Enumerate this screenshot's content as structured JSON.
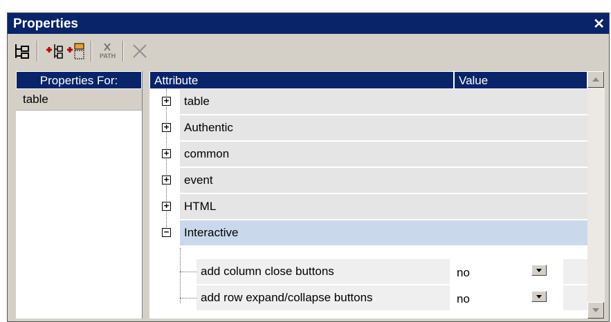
{
  "window": {
    "title": "Properties",
    "close_glyph": "✕"
  },
  "toolbar": {
    "buttons": [
      {
        "icon": "tree-view-icon"
      },
      {
        "icon": "add-property-icon"
      },
      {
        "icon": "add-child-property-icon"
      },
      {
        "icon": "xpath-icon",
        "label": "PATH"
      },
      {
        "icon": "delete-icon"
      }
    ]
  },
  "left": {
    "header": "Properties For:",
    "items": [
      "table"
    ]
  },
  "grid": {
    "attribute_header": "Attribute",
    "value_header": "Value",
    "groups": [
      {
        "label": "table",
        "expanded": false
      },
      {
        "label": "Authentic",
        "expanded": false
      },
      {
        "label": "common",
        "expanded": false
      },
      {
        "label": "event",
        "expanded": false
      },
      {
        "label": "HTML",
        "expanded": false
      },
      {
        "label": "Interactive",
        "expanded": true
      }
    ],
    "children": [
      {
        "attribute": "add column close buttons",
        "value": "no"
      },
      {
        "attribute": "add row expand/collapse buttons",
        "value": "no"
      }
    ]
  },
  "colors": {
    "titlebar": "#0a246a",
    "selected_row": "#c9d9eb",
    "chrome": "#d4d0c8"
  }
}
